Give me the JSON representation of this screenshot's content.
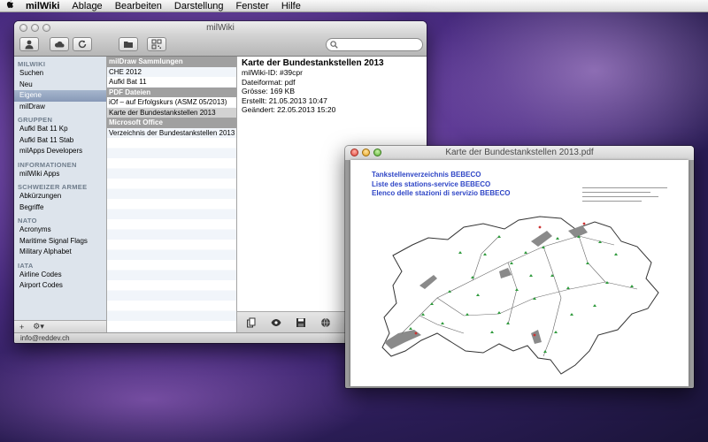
{
  "menubar": {
    "apple": "",
    "app_name": "milWiki",
    "items": [
      "Ablage",
      "Bearbeiten",
      "Darstellung",
      "Fenster",
      "Hilfe"
    ]
  },
  "main_window": {
    "title": "milWiki",
    "search": {
      "placeholder": "",
      "value": ""
    },
    "sidebar": {
      "sections": [
        {
          "header": "MILWIKI",
          "items": [
            "Suchen",
            "Neu",
            "Eigene",
            "milDraw"
          ]
        },
        {
          "header": "GRUPPEN",
          "items": [
            "Aufkl Bat 11 Kp",
            "Aufkl Bat 11 Stab",
            "milApps Developers"
          ]
        },
        {
          "header": "INFORMATIONEN",
          "items": [
            "milWiki Apps"
          ]
        },
        {
          "header": "SCHWEIZER ARMEE",
          "items": [
            "Abkürzungen",
            "Begriffe"
          ]
        },
        {
          "header": "NATO",
          "items": [
            "Acronyms",
            "Maritime Signal Flags",
            "Military Alphabet"
          ]
        },
        {
          "header": "IATA",
          "items": [
            "Airline Codes",
            "Airport Codes"
          ]
        }
      ],
      "selected": "Eigene",
      "footer_add": "+",
      "footer_gear": "⚙▾"
    },
    "list": {
      "groups": [
        {
          "header": "milDraw Sammlungen",
          "items": [
            "CHE 2012",
            "Aufkl Bat 11"
          ]
        },
        {
          "header": "PDF Dateien",
          "items": [
            "iOf – auf Erfolgskurs (ASMZ 05/2013)",
            "Karte der Bundestankstellen 2013"
          ]
        },
        {
          "header": "Microsoft Office",
          "items": [
            "Verzeichnis der Bundestankstellen 2013"
          ]
        }
      ],
      "selected": "Karte der Bundestankstellen 2013"
    },
    "detail": {
      "title": "Karte der Bundestankstellen 2013",
      "id_line": "milWiki-ID: #39cpr",
      "format_line": "Dateiformat: pdf",
      "size_line": "Grösse: 169 KB",
      "created_line": "Erstellt: 21.05.2013 10:47",
      "modified_line": "Geändert: 22.05.2013 15:20"
    },
    "status": "info@reddev.ch"
  },
  "pdf_window": {
    "title": "Karte der Bundestankstellen 2013.pdf",
    "headings": [
      "Tankstellenverzeichnis BEBECO",
      "Liste des stations-service BEBECO",
      "Elenco delle stazioni di servizio BEBECO"
    ]
  },
  "colors": {
    "pdf_heading": "#2f46c6",
    "sidebar_selection": "#8799b7",
    "map_marker": "#2e9a3c",
    "map_lake": "#8a8a8a"
  }
}
